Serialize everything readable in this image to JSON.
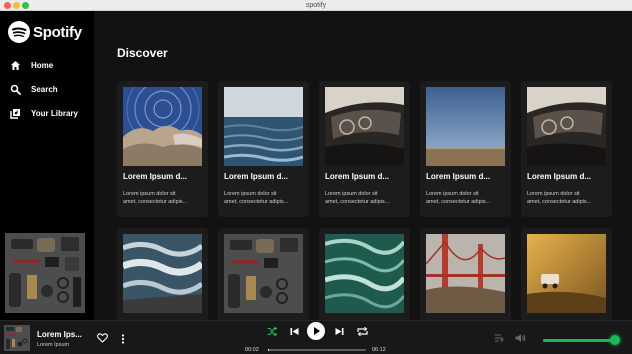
{
  "window": {
    "title": "spotify"
  },
  "brand": {
    "name": "Spotify",
    "accent": "#1db954"
  },
  "sidebar": {
    "items": [
      {
        "label": "Home",
        "icon": "home-icon"
      },
      {
        "label": "Search",
        "icon": "search-icon"
      },
      {
        "label": "Your Library",
        "icon": "library-icon"
      }
    ]
  },
  "main": {
    "title": "Discover",
    "cards": [
      {
        "title": "Lorem Ipsum d...",
        "desc1": "Lorem ipsum dolor sit",
        "desc2": "amet, consectetur adipis...",
        "image": "starry-rocks"
      },
      {
        "title": "Lorem Ipsum d...",
        "desc1": "Lorem ipsum dolor sit",
        "desc2": "amet, consectetur adipis...",
        "image": "ocean"
      },
      {
        "title": "Lorem Ipsum d...",
        "desc1": "Lorem ipsum dolor sit",
        "desc2": "amet, consectetur adipis...",
        "image": "car-interior"
      },
      {
        "title": "Lorem Ipsum d...",
        "desc1": "Lorem ipsum dolor sit",
        "desc2": "amet, consectetur adipis...",
        "image": "horizon"
      },
      {
        "title": "Lorem Ipsum d...",
        "desc1": "Lorem ipsum dolor sit",
        "desc2": "amet, consectetur adipis...",
        "image": "car-interior"
      },
      {
        "title": "",
        "desc1": "",
        "desc2": "",
        "image": "waves"
      },
      {
        "title": "",
        "desc1": "",
        "desc2": "",
        "image": "flatlay"
      },
      {
        "title": "",
        "desc1": "",
        "desc2": "",
        "image": "green-water"
      },
      {
        "title": "",
        "desc1": "",
        "desc2": "",
        "image": "bridge"
      },
      {
        "title": "",
        "desc1": "",
        "desc2": "",
        "image": "desert-car"
      }
    ]
  },
  "player": {
    "track_title": "Lorem Ips...",
    "artist": "Lorem Ipsum",
    "elapsed": "00:02",
    "duration": "06:12",
    "progress": 0.005,
    "volume": 0.97
  }
}
